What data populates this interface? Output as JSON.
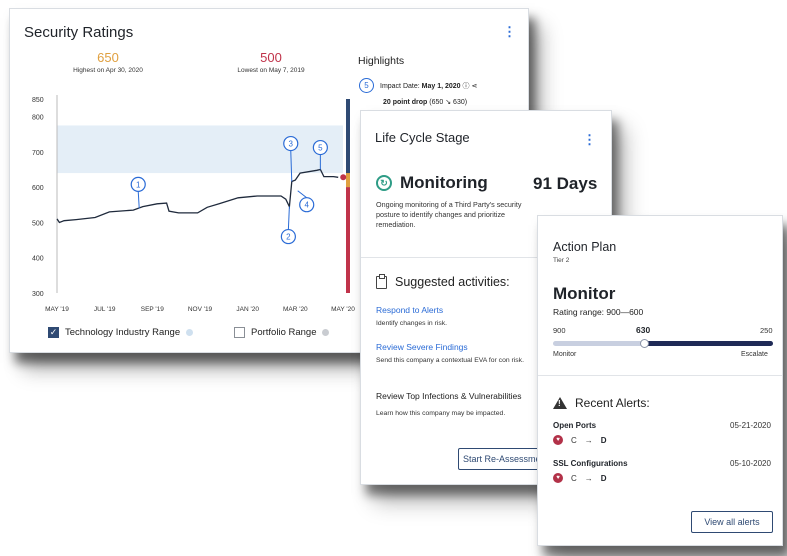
{
  "ratings": {
    "title": "Security Ratings",
    "high": {
      "value": "650",
      "label": "Highest on Apr 30, 2020",
      "color": "#e0a040"
    },
    "low": {
      "value": "500",
      "label": "Lowest on May 7, 2019",
      "color": "#c0334a"
    },
    "legend": [
      {
        "label": "Technology Industry Range",
        "checked": true,
        "dot_color": "#cfe0ef"
      },
      {
        "label": "Portfolio Range",
        "checked": false,
        "dot_color": "#c9ccd1"
      }
    ],
    "highlights": {
      "title": "Highlights",
      "badge": "5",
      "impact_label": "Impact Date:",
      "impact_date": "May 1, 2020",
      "drop_bold": "20 point drop",
      "drop_detail": "(650 ↘ 630)"
    }
  },
  "chart_data": {
    "type": "line",
    "title": "Security Ratings",
    "xlabel": "",
    "ylabel": "",
    "ylim": [
      300,
      850
    ],
    "yticks": [
      300,
      400,
      500,
      600,
      700,
      800,
      850
    ],
    "xticks": [
      "MAY '19",
      "JUL '19",
      "SEP '19",
      "NOV '19",
      "JAN '20",
      "MAR '20",
      "MAY '20"
    ],
    "grid": false,
    "band": {
      "name": "Technology Industry Range",
      "low": 640,
      "high": 775,
      "color": "#e4eef7"
    },
    "series": [
      {
        "name": "Security Rating",
        "color": "#1f2a3c",
        "points": [
          {
            "x": 0.0,
            "y": 510
          },
          {
            "x": 0.1,
            "y": 500
          },
          {
            "x": 0.3,
            "y": 505
          },
          {
            "x": 0.8,
            "y": 508
          },
          {
            "x": 1.6,
            "y": 514
          },
          {
            "x": 2.2,
            "y": 530
          },
          {
            "x": 3.2,
            "y": 535
          },
          {
            "x": 3.6,
            "y": 545
          },
          {
            "x": 4.2,
            "y": 553
          },
          {
            "x": 4.6,
            "y": 555
          },
          {
            "x": 4.7,
            "y": 532
          },
          {
            "x": 5.1,
            "y": 527
          },
          {
            "x": 5.9,
            "y": 527
          },
          {
            "x": 6.3,
            "y": 543
          },
          {
            "x": 6.8,
            "y": 553
          },
          {
            "x": 7.6,
            "y": 570
          },
          {
            "x": 8.4,
            "y": 575
          },
          {
            "x": 9.4,
            "y": 575
          },
          {
            "x": 9.6,
            "y": 566
          },
          {
            "x": 9.75,
            "y": 545
          },
          {
            "x": 9.85,
            "y": 616
          },
          {
            "x": 10.0,
            "y": 620
          },
          {
            "x": 10.2,
            "y": 640
          },
          {
            "x": 10.9,
            "y": 648
          },
          {
            "x": 11.05,
            "y": 650
          },
          {
            "x": 11.2,
            "y": 630
          },
          {
            "x": 11.6,
            "y": 630
          },
          {
            "x": 11.8,
            "y": 628
          }
        ]
      }
    ],
    "markers": [
      {
        "label": "1",
        "x": 3.45,
        "y": 540
      },
      {
        "label": "2",
        "x": 9.75,
        "y": 545
      },
      {
        "label": "3",
        "x": 9.85,
        "y": 616
      },
      {
        "label": "4",
        "x": 10.1,
        "y": 590
      },
      {
        "label": "5",
        "x": 11.05,
        "y": 650
      }
    ],
    "rating_bands": [
      {
        "from": 600,
        "to": 850,
        "color": "#2f4a73"
      },
      {
        "from": 600,
        "to": 640,
        "color": "#e0a040"
      },
      {
        "from": 300,
        "to": 600,
        "color": "#c0334a"
      }
    ]
  },
  "lifecycle": {
    "title": "Life Cycle Stage",
    "stage": "Monitoring",
    "days": "91 Days",
    "description": "Ongoing monitoring of a Third Party's security posture to identify changes and prioritize remediation.",
    "activities_title": "Suggested activities:",
    "activities": [
      {
        "title": "Respond to Alerts",
        "desc": "Identify changes in risk.",
        "link": true
      },
      {
        "title": "Review Severe Findings",
        "desc": "Send this company a contextual EVA for con risk.",
        "link": true
      },
      {
        "title": "Review Top Infections & Vulnerabilities",
        "desc": "Learn how this company may be impacted.",
        "link": false
      }
    ],
    "button": "Start Re-Assessment"
  },
  "action_plan": {
    "title": "Action Plan",
    "tier": "Tier 2",
    "level": "Monitor",
    "range": "Rating range: 900—600",
    "scale": {
      "min": "900",
      "current": "630",
      "max": "250",
      "fraction": 0.415,
      "left": "Monitor",
      "right": "Escalate"
    },
    "alerts_title": "Recent Alerts:",
    "alerts": [
      {
        "name": "Open Ports",
        "date": "05-21-2020",
        "from": "C",
        "to": "D"
      },
      {
        "name": "SSL Configurations",
        "date": "05-10-2020",
        "from": "C",
        "to": "D"
      }
    ],
    "button": "View all alerts"
  }
}
